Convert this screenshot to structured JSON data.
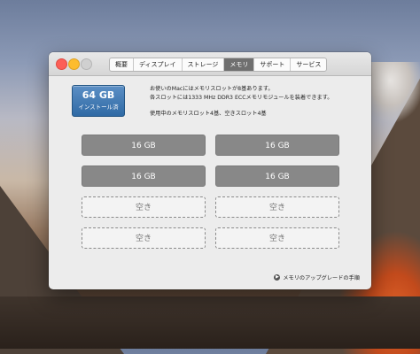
{
  "window": {
    "tabs": [
      {
        "label": "概要"
      },
      {
        "label": "ディスプレイ"
      },
      {
        "label": "ストレージ"
      },
      {
        "label": "メモリ"
      },
      {
        "label": "サポート"
      },
      {
        "label": "サービス"
      }
    ],
    "active_tab": "メモリ"
  },
  "memory": {
    "total_size": "64 GB",
    "total_label": "インストール済",
    "info_line1": "お使いのMacにはメモリスロットが8基あります。",
    "info_line2": "各スロットには1333 MHz DDR3 ECCメモリモジュールを装着できます。",
    "info_line3": "使用中のメモリスロット4基、空きスロット4基",
    "slots": [
      {
        "label": "16 GB",
        "state": "filled"
      },
      {
        "label": "16 GB",
        "state": "filled"
      },
      {
        "label": "16 GB",
        "state": "filled"
      },
      {
        "label": "16 GB",
        "state": "filled"
      },
      {
        "label": "空き",
        "state": "empty"
      },
      {
        "label": "空き",
        "state": "empty"
      },
      {
        "label": "空き",
        "state": "empty"
      },
      {
        "label": "空き",
        "state": "empty"
      }
    ],
    "upgrade_link": "メモリのアップグレードの手順",
    "upgrade_icon": "arrow-circle-right-icon"
  },
  "colors": {
    "badge": "#2f6aa5",
    "filled_slot": "#888888",
    "active_tab": "#6f6f6f"
  }
}
